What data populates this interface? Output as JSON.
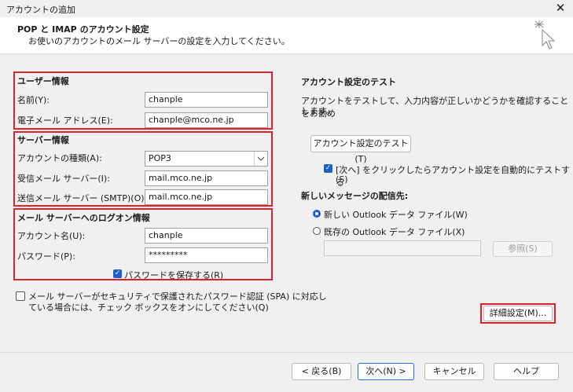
{
  "window": {
    "title": "アカウントの追加",
    "close_glyph": "✕"
  },
  "header": {
    "title": "POP と IMAP のアカウント設定",
    "subtitle": "お使いのアカウントのメール サーバーの設定を入力してください。",
    "icon": "cursor-sparkle-icon"
  },
  "user_info": {
    "heading": "ユーザー情報",
    "name_label": "名前(Y):",
    "name_value": "chanple",
    "email_label": "電子メール アドレス(E):",
    "email_value": "chanple@mco.ne.jp"
  },
  "server_info": {
    "heading": "サーバー情報",
    "account_type_label": "アカウントの種類(A):",
    "account_type_value": "POP3",
    "incoming_label": "受信メール サーバー(I):",
    "incoming_value": "mail.mco.ne.jp",
    "outgoing_label": "送信メール サーバー (SMTP)(O):",
    "outgoing_value": "mail.mco.ne.jp"
  },
  "logon_info": {
    "heading": "メール サーバーへのログオン情報",
    "account_name_label": "アカウント名(U):",
    "account_name_value": "chanple",
    "password_label": "パスワード(P):",
    "password_value": "*********",
    "remember_label": "パスワードを保存する(R)",
    "remember_checked": true
  },
  "spa": {
    "label_line1": "メール サーバーがセキュリティで保護されたパスワード認証 (SPA) に対応し",
    "label_line2": "ている場合には、チェック ボックスをオンにしてください(Q)",
    "checked": false
  },
  "test": {
    "heading": "アカウント設定のテスト",
    "desc_line1": "アカウントをテストして、入力内容が正しいかどうかを確認することをお勧め",
    "desc_line2": "します。",
    "button_label": "アカウント設定のテスト(T)",
    "auto_test_line1": "[次へ] をクリックしたらアカウント設定を自動的にテストする",
    "auto_test_line2": "(S)",
    "auto_test_checked": true
  },
  "delivery": {
    "heading": "新しいメッセージの配信先:",
    "option_new": "新しい Outlook データ ファイル(W)",
    "option_existing": "既存の Outlook データ ファイル(X)",
    "selected": "new",
    "path_value": "",
    "browse_label": "参照(S)"
  },
  "advanced": {
    "label": "詳細設定(M)..."
  },
  "footer": {
    "back_label": "< 戻る(B)",
    "next_label": "次へ(N) >",
    "cancel_label": "キャンセル",
    "help_label": "ヘルプ"
  },
  "colors": {
    "highlight_border": "#e0202a",
    "accent": "#1e5fc6"
  }
}
